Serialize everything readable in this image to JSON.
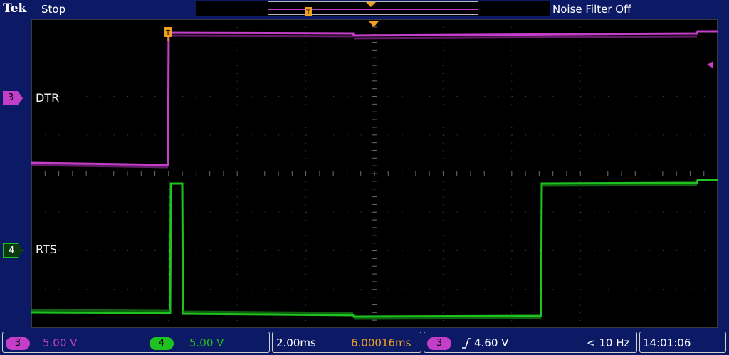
{
  "header": {
    "brand": "Tek",
    "acquisition_status": "Stop",
    "noise_filter": "Noise Filter Off"
  },
  "channels": [
    {
      "number": "3",
      "label": "DTR",
      "color": "#c33fc9"
    },
    {
      "number": "4",
      "label": "RTS",
      "color": "#1fc21f"
    }
  ],
  "footer": {
    "ch3_scale": "5.00 V",
    "ch4_scale": "5.00 V",
    "timebase": "2.00ms",
    "trigger_position": "6.00016ms",
    "trigger_channel": "3",
    "trigger_level": "4.60 V",
    "trigger_frequency": "< 10 Hz",
    "time": "14:01:06"
  },
  "colors": {
    "background": "#0c1a66",
    "screen": "#000000",
    "ch3": "#c33fc9",
    "ch4": "#1fc21f",
    "trigger": "#f0a020"
  },
  "icons": {
    "trigger_marker": "trigger-t-icon",
    "trigger_slope": "rising-edge-icon",
    "trigger_level": "level-arrow-icon"
  }
}
